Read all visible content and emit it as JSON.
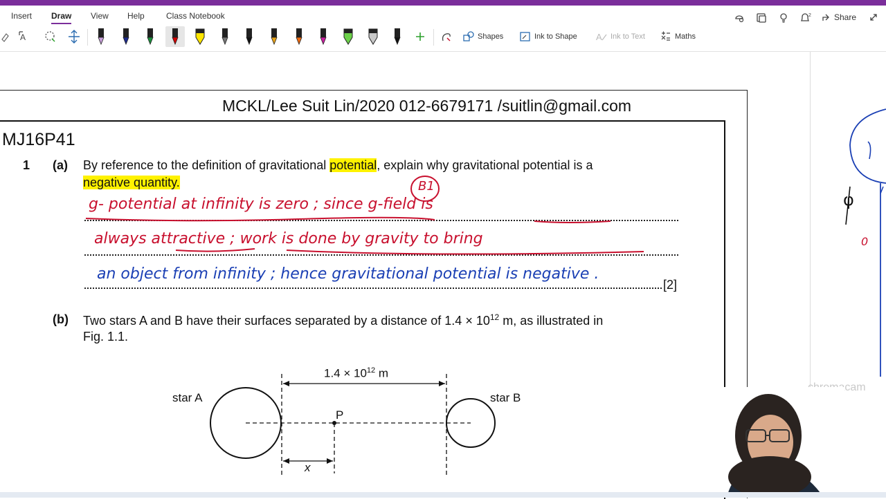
{
  "ribbon": {
    "tabs": [
      {
        "label": "Insert",
        "active": false
      },
      {
        "label": "Draw",
        "active": true
      },
      {
        "label": "View",
        "active": false
      },
      {
        "label": "Help",
        "active": false
      },
      {
        "label": "Class Notebook",
        "active": false
      }
    ],
    "share_label": "Share"
  },
  "toolbar": {
    "shapes_label": "Shapes",
    "ink_to_shape_label": "Ink to Shape",
    "ink_to_text_label": "Ink to Text",
    "maths_label": "Maths"
  },
  "pens": [
    {
      "name": "pen-purple",
      "color": "#c9a0dc"
    },
    {
      "name": "pen-navy",
      "color": "#1b2a8c"
    },
    {
      "name": "pen-green",
      "color": "#1a8f3c"
    },
    {
      "name": "pen-red",
      "color": "#d40000",
      "selected": true
    },
    {
      "name": "highlighter-yellow",
      "color": "#ffe600"
    },
    {
      "name": "pen-gray",
      "color": "#777777"
    },
    {
      "name": "pen-black",
      "color": "#111111"
    },
    {
      "name": "pen-rainbow",
      "color": "#e8a317"
    },
    {
      "name": "pen-orange",
      "color": "#f26b0f"
    },
    {
      "name": "pen-magenta",
      "color": "#cc1fa2"
    },
    {
      "name": "highlighter-green",
      "color": "#6cd14a"
    },
    {
      "name": "highlighter-gray",
      "color": "#c8c8c8"
    },
    {
      "name": "pen-black-fine",
      "color": "#111111"
    }
  ],
  "document": {
    "header": "MCKL/Lee Suit Lin/2020   012-6679171 /suitlin@gmail.com",
    "question_id": "MJ16P41",
    "q_number": "1",
    "part_a_label": "(a)",
    "part_a_text_1": "By reference to the definition of gravitational ",
    "part_a_highlight_1": "potential",
    "part_a_text_2": ", explain why gravitational potential is a",
    "part_a_highlight_2": "negative quantity.",
    "part_a_marks": "[2]",
    "part_b_label": "(b)",
    "part_b_text_1": "Two stars A and B have their surfaces separated by a distance of 1.4 × 10",
    "part_b_sup": "12",
    "part_b_text_2": " m, as illustrated in",
    "part_b_text_3": "Fig. 1.1."
  },
  "handwriting": {
    "circled_mark": "B1",
    "line1": "g- potential  at  infinity  is  zero ;  since  g-field  is",
    "line2": "always  attractive ;  work  is  done  by  gravity  to  bring",
    "line3": "an  object  from  infinity ;  hence  gravitational  potential  is  negative ."
  },
  "diagram": {
    "star_a": "star A",
    "star_b": "star B",
    "point_p": "P",
    "distance_label": "1.4 × 10",
    "distance_sup": "12",
    "distance_unit": " m",
    "x_label": "x"
  },
  "side_panel": {
    "phi_label": "φ",
    "zero_label": "0"
  },
  "watermark": "chromacam",
  "colors": {
    "accent": "#7b2e9b",
    "highlight": "#fff200",
    "ink_red": "#c8102e",
    "ink_blue": "#1a3fb4"
  }
}
